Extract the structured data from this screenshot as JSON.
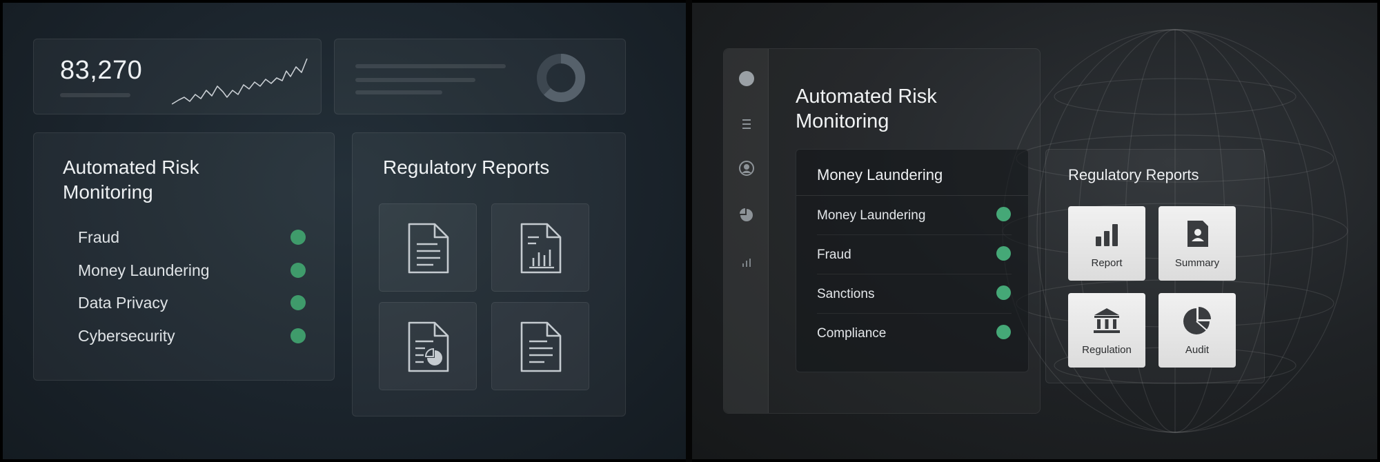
{
  "left_dashboard": {
    "stat": {
      "value": "83,270"
    },
    "risk_card": {
      "title_line1": "Automated Risk",
      "title_line2": "Monitoring",
      "items": [
        {
          "label": "Fraud",
          "status": "active"
        },
        {
          "label": "Money Laundering",
          "status": "active"
        },
        {
          "label": "Data Privacy",
          "status": "active"
        },
        {
          "label": "Cybersecurity",
          "status": "active"
        }
      ]
    },
    "reports_card": {
      "title": "Regulatory Reports",
      "tiles": [
        {
          "icon": "text-document-icon"
        },
        {
          "icon": "chart-document-icon"
        },
        {
          "icon": "pie-document-icon"
        },
        {
          "icon": "text-document-icon"
        }
      ]
    }
  },
  "right_dashboard": {
    "sidebar": {
      "icons": [
        "circle-icon",
        "menu-icon",
        "user-icon",
        "pie-chart-icon",
        "bar-chart-icon"
      ]
    },
    "title_line1": "Automated Risk",
    "title_line2": "Monitoring",
    "risk_card": {
      "heading": "Money Laundering",
      "items": [
        {
          "label": "Money Laundering",
          "status": "active"
        },
        {
          "label": "Fraud",
          "status": "active"
        },
        {
          "label": "Sanctions",
          "status": "active"
        },
        {
          "label": "Compliance",
          "status": "active"
        }
      ]
    },
    "reports_card": {
      "title": "Regulatory Reports",
      "tiles": [
        {
          "label": "Report",
          "icon": "bar-chart-icon"
        },
        {
          "label": "Summary",
          "icon": "user-document-icon"
        },
        {
          "label": "Regulation",
          "icon": "bank-icon"
        },
        {
          "label": "Audit",
          "icon": "pie-chart-icon"
        }
      ]
    }
  },
  "colors": {
    "status_green": "#3f9b6b",
    "left_background": "#1b242c",
    "right_background": "#1f2225",
    "tile_light": "#ececec"
  }
}
